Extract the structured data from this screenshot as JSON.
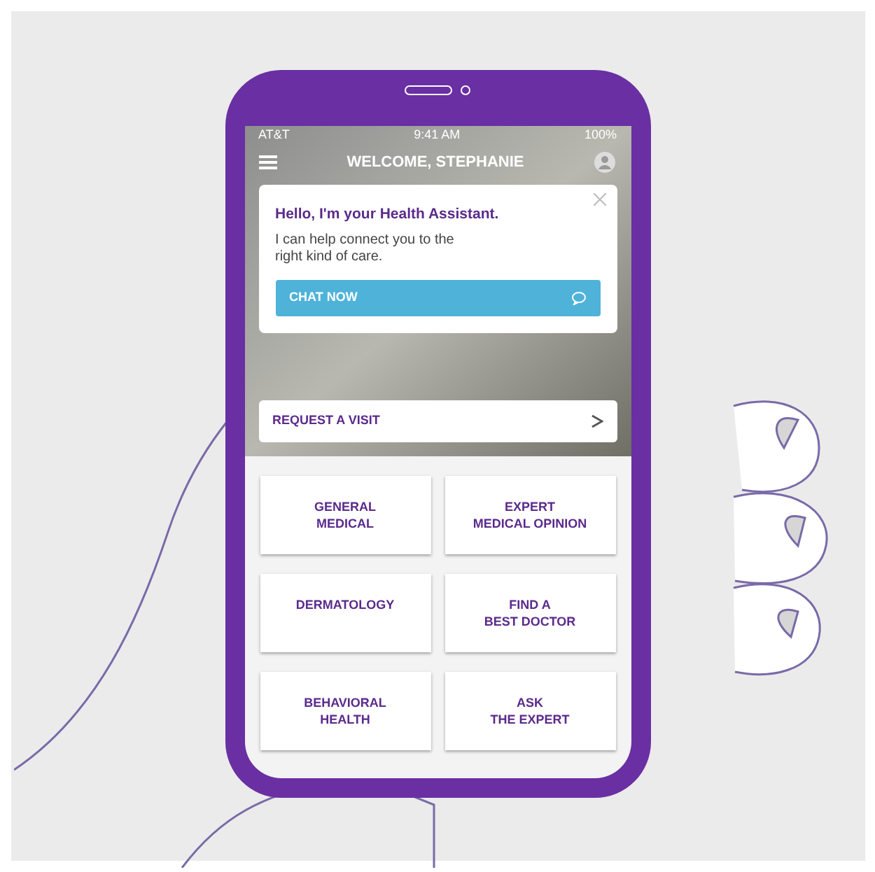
{
  "status_bar": {
    "carrier": "AT&T",
    "time": "9:41 AM",
    "battery": "100%"
  },
  "header": {
    "title": "WELCOME, STEPHANIE"
  },
  "assistant_card": {
    "title": "Hello, I'm your Health Assistant.",
    "message": "I can help connect you to the right kind of care.",
    "button": "CHAT NOW"
  },
  "request_visit": {
    "label": "REQUEST A VISIT"
  },
  "tiles": [
    {
      "label": "GENERAL\nMEDICAL"
    },
    {
      "label": "EXPERT\nMEDICAL OPINION"
    },
    {
      "label": "DERMATOLOGY"
    },
    {
      "label": "FIND A\nBEST DOCTOR"
    },
    {
      "label": "BEHAVIORAL\nHEALTH"
    },
    {
      "label": "ASK\nTHE EXPERT"
    }
  ]
}
